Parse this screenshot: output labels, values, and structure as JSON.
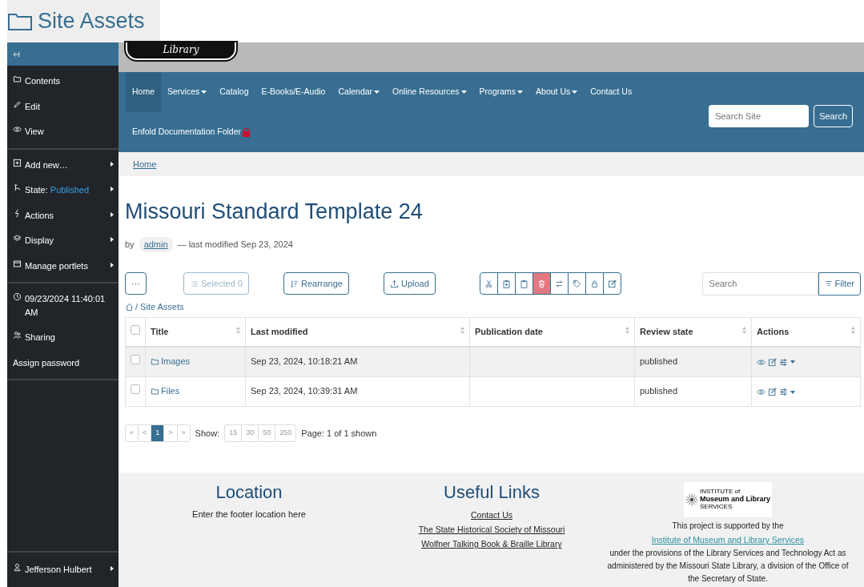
{
  "window": {
    "title": "Site Assets"
  },
  "toolbar": {
    "sections": [
      [
        {
          "kind": "folder",
          "label": "Contents",
          "submenu": false
        },
        {
          "kind": "pencil",
          "label": "Edit",
          "submenu": false
        },
        {
          "kind": "eye",
          "label": "View",
          "submenu": false
        }
      ],
      [
        {
          "kind": "plus",
          "label": "Add new…",
          "submenu": true
        },
        {
          "kind": "state",
          "label": "State:",
          "value": "Published",
          "submenu": true
        },
        {
          "kind": "bolt",
          "label": "Actions",
          "submenu": true
        },
        {
          "kind": "layers",
          "label": "Display",
          "submenu": true
        },
        {
          "kind": "window",
          "label": "Manage portlets",
          "submenu": true
        }
      ],
      [
        {
          "kind": "clock",
          "label": "09/23/2024 11:40:01 AM",
          "submenu": false
        },
        {
          "kind": "people",
          "label": "Sharing",
          "submenu": false
        },
        {
          "kind": "text",
          "label": "Assign password",
          "submenu": false
        }
      ]
    ],
    "user": {
      "label": "Jefferson Hulbert",
      "submenu": true
    }
  },
  "site": {
    "logo_text": "Library",
    "nav": [
      {
        "label": "Home",
        "selected": true,
        "dropdown": false,
        "locked": false
      },
      {
        "label": "Services",
        "selected": false,
        "dropdown": true,
        "locked": false
      },
      {
        "label": "Catalog",
        "selected": false,
        "dropdown": false,
        "locked": false
      },
      {
        "label": "E-Books/E-Audio",
        "selected": false,
        "dropdown": false,
        "locked": false
      },
      {
        "label": "Calendar",
        "selected": false,
        "dropdown": true,
        "locked": false
      },
      {
        "label": "Online Resources",
        "selected": false,
        "dropdown": true,
        "locked": false
      },
      {
        "label": "Programs",
        "selected": false,
        "dropdown": true,
        "locked": false
      },
      {
        "label": "About Us",
        "selected": false,
        "dropdown": true,
        "locked": false
      },
      {
        "label": "Contact Us",
        "selected": false,
        "dropdown": false,
        "locked": false
      },
      {
        "label": "Enfold Documentation Folder",
        "selected": false,
        "dropdown": false,
        "locked": true
      }
    ],
    "search": {
      "placeholder": "Search Site",
      "button": "Search"
    }
  },
  "breadcrumbs": [
    "Home"
  ],
  "page": {
    "title": "Missouri Standard Template 24",
    "by": "by",
    "author": "admin",
    "modified": "— last modified Sep 23, 2024"
  },
  "folder_toolbar": {
    "more": "···",
    "selected": {
      "label": "Selected 0",
      "disabled": true
    },
    "rearrange": "Rearrange",
    "upload": "Upload",
    "actions": [
      {
        "kind": "scissors",
        "danger": false
      },
      {
        "kind": "clipboard-plus",
        "danger": false
      },
      {
        "kind": "clipboard",
        "danger": false
      },
      {
        "kind": "trash",
        "danger": true
      },
      {
        "kind": "arrows",
        "danger": false
      },
      {
        "kind": "tag",
        "danger": false
      },
      {
        "kind": "lock",
        "danger": false
      },
      {
        "kind": "edit",
        "danger": false
      }
    ],
    "search": {
      "placeholder": "Search"
    },
    "filter": "Filter"
  },
  "path": "/ Site Assets",
  "table": {
    "select_all": {
      "checked": false
    },
    "columns": [
      "Title",
      "Last modified",
      "Publication date",
      "Review state",
      "Actions"
    ],
    "rows": [
      {
        "checked": false,
        "title": "Images",
        "modified": "Sep 23, 2024, 10:18:21 AM",
        "published": "",
        "state": "published"
      },
      {
        "checked": false,
        "title": "Files",
        "modified": "Sep 23, 2024, 10:39:31 AM",
        "published": "",
        "state": "published"
      }
    ]
  },
  "pagination": {
    "pages": [
      {
        "label": "«",
        "selected": false
      },
      {
        "label": "<",
        "selected": false
      },
      {
        "label": "1",
        "selected": true
      },
      {
        "label": ">",
        "selected": false
      },
      {
        "label": "»",
        "selected": false
      }
    ],
    "show_label": "Show:",
    "show_options": [
      "15",
      "30",
      "50",
      "250"
    ],
    "info": "Page: 1 of 1 shown"
  },
  "footer": {
    "location": {
      "title": "Location",
      "text": "Enter the footer location here"
    },
    "links": {
      "title": "Useful Links",
      "items": [
        "Contact Us",
        "The State Historical Society of Missouri",
        "Wolfner Talking Book & Braille Library"
      ]
    },
    "sponsor": {
      "logo_lines": [
        "INSTITUTE of",
        "Museum and Library",
        "SERVICES"
      ],
      "before": "This project is supported by the",
      "link": "Institute of Museum and Library Services",
      "after": "under the provisions of the Library Services and Technology Act as administered by the Missouri State Library, a division of the Office of the Secretary of State."
    }
  }
}
